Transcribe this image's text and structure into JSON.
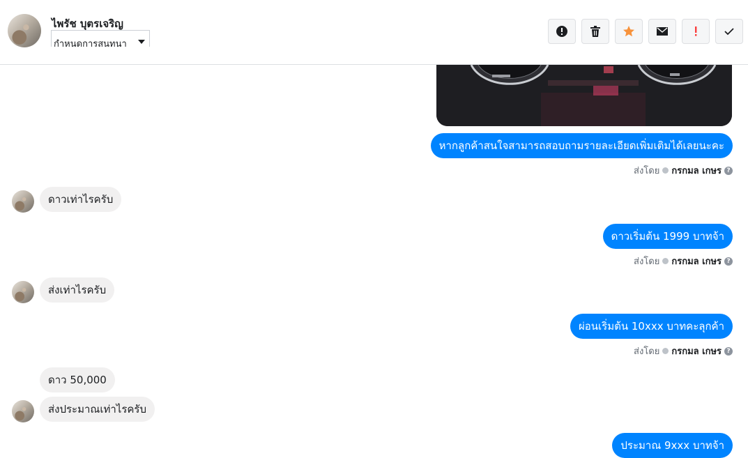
{
  "header": {
    "contact_name": "ไพรัช บุตรเจริญ",
    "assign_label": "กำหนดการสนทนา",
    "buttons": [
      {
        "name": "spam-button",
        "icon": "alert-circle-icon"
      },
      {
        "name": "delete-button",
        "icon": "trash-icon"
      },
      {
        "name": "star-button",
        "icon": "star-icon",
        "color": "#f7923b"
      },
      {
        "name": "mark-unread-button",
        "icon": "envelope-icon"
      },
      {
        "name": "mark-important-button",
        "icon": "exclamation-icon",
        "color": "#fa3e3e"
      },
      {
        "name": "mark-done-button",
        "icon": "checkmark-icon"
      }
    ]
  },
  "messages": {
    "out1": "หากลูกค้าสนใจสามารถสอบถามรายละเอียดเพิ่มเติมได้เลยนะคะ",
    "in1": "ดาวเท่าไรครับ",
    "out2": "ดาวเริ่มต้น 1999 บาทจ้า",
    "in2": "ส่งเท่าไรครับ",
    "out3": "ผ่อนเริ่มต้น 10xxx บาทคะลุกค้า",
    "in3a": "ดาว 50,000",
    "in3b": "ส่งประมาณเท่าไรครับ",
    "out4": "ประมาณ 9xxx บาทจ้า"
  },
  "sent_by": {
    "prefix": "ส่งโดย",
    "name": "กรกมล เกษร"
  },
  "colors": {
    "outgoing_bubble": "#0084ff",
    "incoming_bubble": "#f1f0f0"
  }
}
